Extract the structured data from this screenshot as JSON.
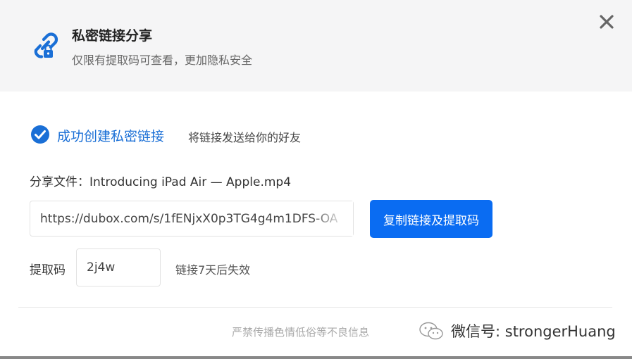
{
  "dialog": {
    "title": "私密链接分享",
    "subtitle": "仅限有提取码可查看，更加隐私安全",
    "header_icon": "link-lock-icon",
    "close_icon": "close-icon"
  },
  "success": {
    "icon": "check-circle-icon",
    "message": "成功创建私密链接",
    "hint": "将链接发送给你的好友"
  },
  "file": {
    "label": "分享文件：Introducing iPad Air — Apple.mp4"
  },
  "link": {
    "url": "https://dubox.com/s/1fENjxX0p3TG4g4m1DFS-OA",
    "copy_button": "复制链接及提取码"
  },
  "code": {
    "label": "提取码",
    "value": "2j4w",
    "expire_note": "链接7天后失效"
  },
  "footer": {
    "warning": "严禁传播色情低俗等不良信息",
    "watermark": "微信号: strongerHuang",
    "watermark_icon": "wechat-icon"
  },
  "colors": {
    "accent": "#0a6cf2",
    "success_text": "#1a6fd6",
    "header_bg": "#f5f5f6"
  }
}
